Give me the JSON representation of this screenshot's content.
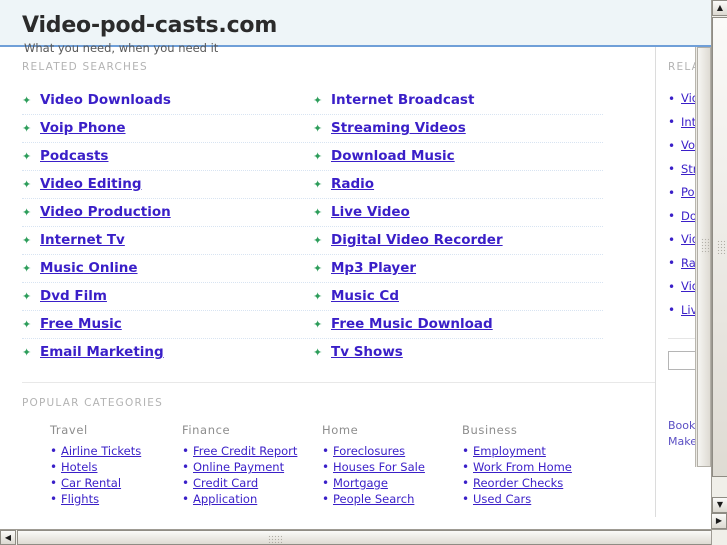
{
  "header": {
    "title": "Video-pod-casts.com",
    "tagline": "What you need, when you need it"
  },
  "related": {
    "label": "RELATED SEARCHES",
    "bullet_glyph": "✦",
    "column_left": [
      "Video Downloads",
      "Voip Phone",
      "Podcasts",
      "Video Editing",
      "Video Production",
      "Internet Tv",
      "Music Online",
      "Dvd Film",
      "Free Music",
      "Email Marketing"
    ],
    "column_right": [
      "Internet Broadcast",
      "Streaming Videos",
      "Download Music",
      "Radio",
      "Live Video",
      "Digital Video Recorder",
      "Mp3 Player",
      "Music Cd",
      "Free Music Download",
      "Tv Shows"
    ]
  },
  "categories": {
    "label": "POPULAR CATEGORIES",
    "bullet_glyph": "•",
    "groups": [
      {
        "title": "Travel",
        "items": [
          "Airline Tickets",
          "Hotels",
          "Car Rental",
          "Flights"
        ]
      },
      {
        "title": "Finance",
        "items": [
          "Free Credit Report",
          "Online Payment",
          "Credit Card",
          "Application"
        ]
      },
      {
        "title": "Home",
        "items": [
          "Foreclosures",
          "Houses For Sale",
          "Mortgage",
          "People Search"
        ]
      },
      {
        "title": "Business",
        "items": [
          "Employment",
          "Work From Home",
          "Reorder Checks",
          "Used Cars"
        ]
      }
    ]
  },
  "rail": {
    "label": "RELATED",
    "bullet_glyph": "•",
    "items": [
      "Video Downloads",
      "Internet Broadcast",
      "Voip Phone",
      "Streaming Videos",
      "Podcasts",
      "Download Music",
      "Video Editing",
      "Radio",
      "Video Production",
      "Live Video"
    ],
    "search_value": "",
    "search_placeholder": "",
    "bookmark_line1": "Bookmark",
    "bookmark_line2": "Make this"
  },
  "scrollbars": {
    "up_arrow": "▲",
    "down_arrow": "▼",
    "left_arrow": "◀",
    "right_arrow": "▶"
  },
  "colors": {
    "link": "#3a1fc8",
    "header_bg": "#eef5f8",
    "header_rule": "#6f9fd8",
    "star_bullet": "#2e9e5b",
    "section_label": "#b3b3b3"
  }
}
